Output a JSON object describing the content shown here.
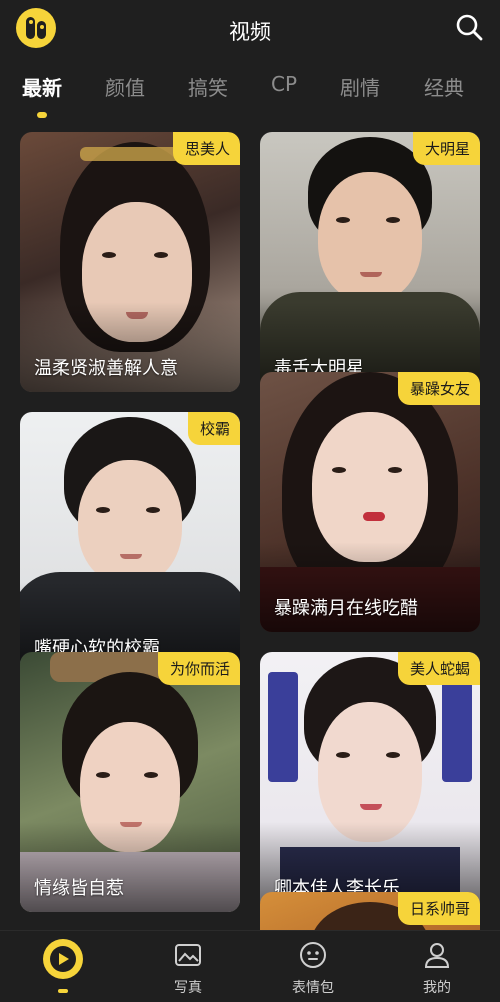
{
  "header": {
    "title": "视频",
    "logo_icon": "app-logo-icon",
    "search_icon": "search-icon"
  },
  "tabs": [
    {
      "label": "最新",
      "active": true
    },
    {
      "label": "颜值",
      "active": false
    },
    {
      "label": "搞笑",
      "active": false
    },
    {
      "label": "CP",
      "active": false
    },
    {
      "label": "剧情",
      "active": false
    },
    {
      "label": "经典",
      "active": false
    }
  ],
  "cards": [
    {
      "badge": "思美人",
      "caption": "温柔贤淑善解人意"
    },
    {
      "badge": "大明星",
      "caption": "毒舌大明星"
    },
    {
      "badge": "校霸",
      "caption": "嘴硬心软的校霸"
    },
    {
      "badge": "暴躁女友",
      "caption": "暴躁满月在线吃醋"
    },
    {
      "badge": "为你而活",
      "caption": "情缘皆自惹"
    },
    {
      "badge": "美人蛇蝎",
      "caption": "卿本佳人李长乐"
    },
    {
      "badge": "日系帅哥",
      "caption": ""
    }
  ],
  "bottom_nav": {
    "items": [
      {
        "label": "",
        "icon": "play-disc-icon",
        "active": true
      },
      {
        "label": "写真",
        "icon": "photo-icon",
        "active": false
      },
      {
        "label": "表情包",
        "icon": "emoji-icon",
        "active": false
      },
      {
        "label": "我的",
        "icon": "user-icon",
        "active": false
      }
    ]
  },
  "colors": {
    "background": "#1f1f1f",
    "accent": "#f6d43a",
    "inactive_tab": "#8c8c8c"
  }
}
